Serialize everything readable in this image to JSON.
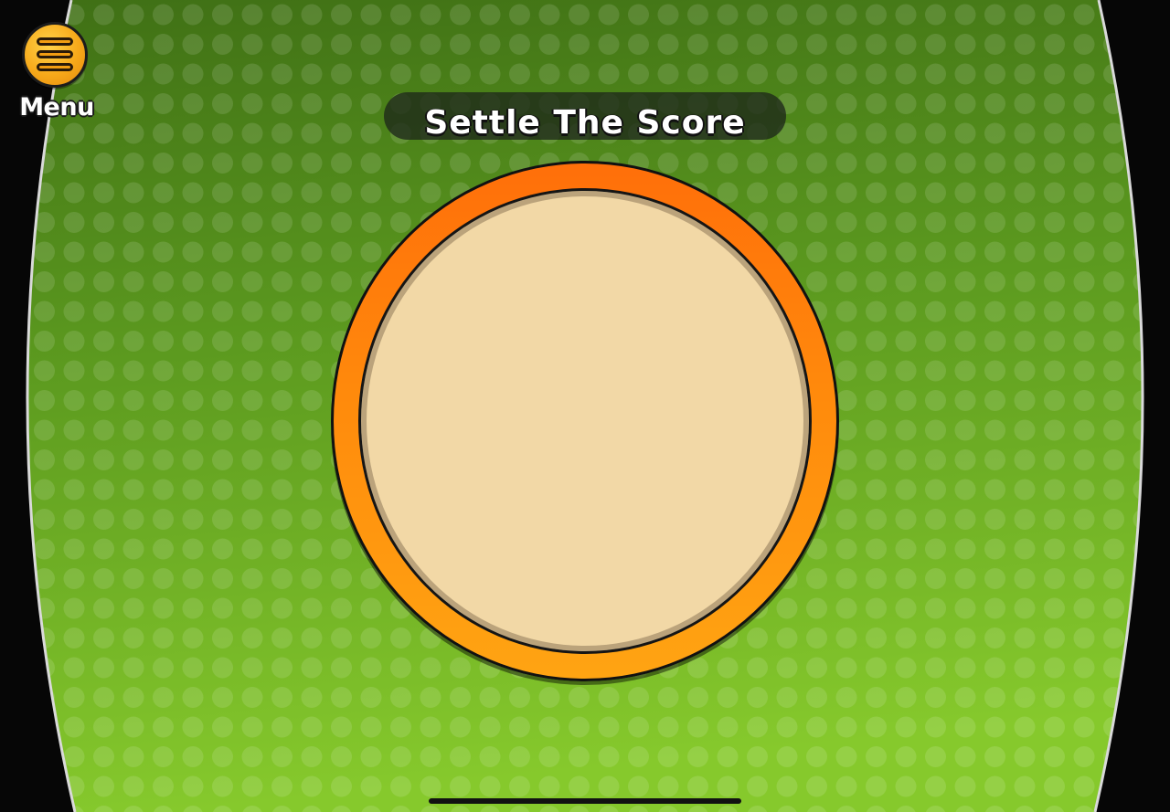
{
  "menu": {
    "label": "Menu",
    "icon": "hamburger-icon"
  },
  "title": {
    "text": "Settle The Score"
  },
  "colors": {
    "background_green_light": "#7fc62a",
    "background_green_dark": "#3d6e14",
    "ring_orange": "#ff8a0c",
    "plate_tan": "#f2d8a6",
    "menu_yellow": "#f7a91a"
  }
}
